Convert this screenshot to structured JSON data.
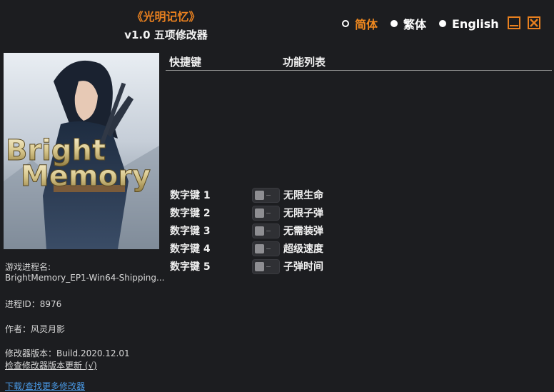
{
  "header": {
    "game_title": "《光明记忆》",
    "subtitle": "v1.0 五项修改器"
  },
  "languages": [
    {
      "label": "简体",
      "selected": true
    },
    {
      "label": "繁体",
      "selected": false
    },
    {
      "label": "English",
      "selected": false
    }
  ],
  "window_controls": {
    "minimize_icon": "minimize-icon",
    "close_icon": "close-icon"
  },
  "colors": {
    "accent": "#e8801f",
    "background": "#1c1d20",
    "link_blue": "#4a9be8"
  },
  "cover": {
    "logo_line1": "Bright",
    "logo_line2": "Memory"
  },
  "info": {
    "process_label": "游戏进程名:",
    "process_name": "BrightMemory_EP1-Win64-Shipping...",
    "pid_line": "进程ID：8976",
    "author_line": "作者：风灵月影",
    "version_line": "修改器版本：Build.2020.12.01",
    "check_update": "检查修改器版本更新 (√)",
    "download_more": "下载/查找更多修改器"
  },
  "table": {
    "col_hotkey": "快捷键",
    "col_features": "功能列表",
    "rows": [
      {
        "key": "数字键 1",
        "feature": "无限生命",
        "enabled": false
      },
      {
        "key": "数字键 2",
        "feature": "无限子弹",
        "enabled": false
      },
      {
        "key": "数字键 3",
        "feature": "无需装弹",
        "enabled": false
      },
      {
        "key": "数字键 4",
        "feature": "超级速度",
        "enabled": false
      },
      {
        "key": "数字键 5",
        "feature": "子弹时间",
        "enabled": false
      }
    ]
  }
}
